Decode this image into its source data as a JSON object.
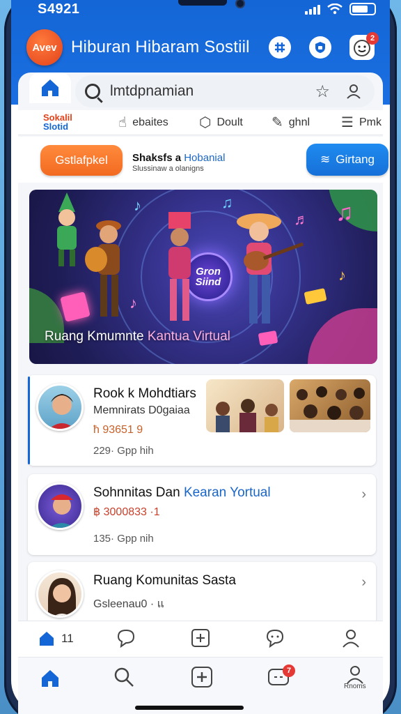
{
  "status": {
    "time": "S4921"
  },
  "header": {
    "logo_text": "Avev",
    "title": "Hiburan Hibaram Sostiil",
    "notification_count": "2"
  },
  "search": {
    "placeholder": "lmtdpnamian"
  },
  "categories": [
    {
      "label": "ebaites",
      "icon": "thumb-icon"
    },
    {
      "label": "Doult",
      "icon": "cube-icon"
    },
    {
      "label": "ghnl",
      "icon": "pen-icon"
    },
    {
      "label": "Pmk",
      "icon": "list-icon"
    }
  ],
  "category_logo": {
    "line1": "Sokalil",
    "line2": "Slotid"
  },
  "promo": {
    "left_button": "Gstlafpkel",
    "title": "Shaksfs a",
    "title_highlight": "Hobanial",
    "subtitle": "Slussinaw  a olanigns",
    "right_button": "Girtang"
  },
  "banner": {
    "badge": "Gron Siind",
    "caption": "Ruang Kmumnte",
    "caption_highlight": "Kantua Virtual"
  },
  "cards": [
    {
      "title": "Rook k Mohdtiars",
      "meta": "Memnirats D0gaiaa",
      "meta2": "ħ 93651 9",
      "count": "229· Gpp hih"
    },
    {
      "title": "Sohnnitas Dan",
      "title_highlight": "Kearan Yortual",
      "meta2": "฿ 3000833 ·1",
      "count": "135· Gpp nih"
    },
    {
      "title": "Ruang Komunitas Sasta",
      "meta": "Gsleenau0 · แ"
    }
  ],
  "nav_top": {
    "home_count": "11"
  },
  "nav_bottom": {
    "message_count": "7",
    "profile_label": "Rnoms"
  },
  "colors": {
    "primary": "#1466d6",
    "orange": "#f26a20",
    "badge": "#e53935"
  }
}
